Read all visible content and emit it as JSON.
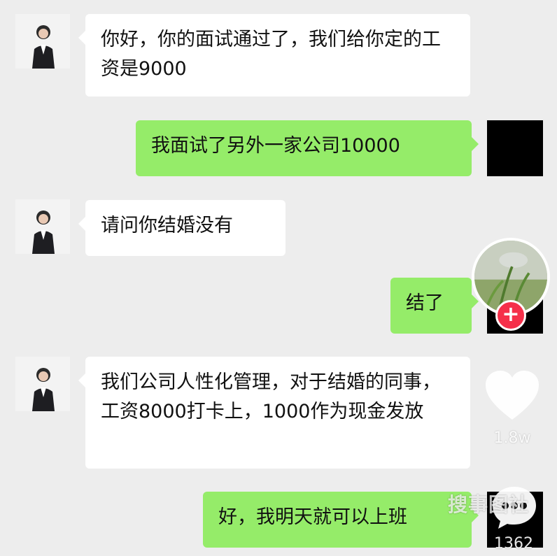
{
  "chat": {
    "messages": [
      {
        "side": "left",
        "text": "你好，你的面试通过了，我们给你定的工资是9000"
      },
      {
        "side": "right",
        "text": "我面试了另外一家公司10000"
      },
      {
        "side": "left",
        "text": "请问你结婚没有"
      },
      {
        "side": "right",
        "text": "结了"
      },
      {
        "side": "left",
        "text": "我们公司人性化管理，对于结婚的同事，工资8000打卡上，1000作为现金发放"
      },
      {
        "side": "right",
        "text": "好，我明天就可以上班"
      }
    ]
  },
  "overlay": {
    "follow_symbol": "+",
    "like_count": "1.8w",
    "comment_count": "1362",
    "watermark": "搜事图社",
    "icons": [
      "creator-avatar-icon",
      "follow-plus-icon",
      "heart-icon",
      "comment-icon"
    ],
    "colors": {
      "chat_bg": "#ededed",
      "left_bubble": "#ffffff",
      "right_bubble": "#95ec69",
      "follow": "#f5304a"
    }
  }
}
